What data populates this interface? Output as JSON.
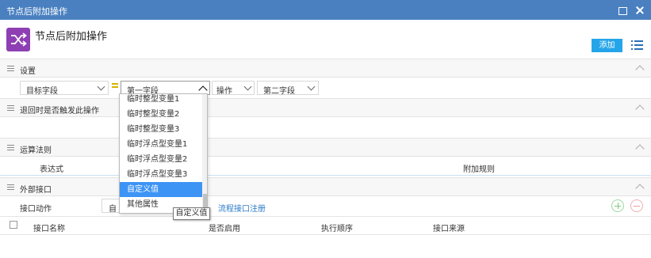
{
  "window": {
    "title": "节点后附加操作"
  },
  "header": {
    "title": "节点后附加操作",
    "add_label": "添加"
  },
  "sections": {
    "settings": "设置",
    "rollback": "退回时是否触发此操作",
    "rules": "运算法则",
    "external": "外部接口"
  },
  "settings_row": {
    "target_field": "目标字段",
    "first_field": "第一字段",
    "operation": "操作",
    "second_field": "第二字段"
  },
  "dropdown": {
    "items": [
      "临时整型变量1",
      "临时整型变量2",
      "临时整型变量3",
      "临时浮点型变量1",
      "临时浮点型变量2",
      "临时浮点型变量3",
      "自定义值",
      "其他属性"
    ],
    "selected": "自定义值"
  },
  "tooltip": "自定义值",
  "rules_table": {
    "columns": [
      "表达式",
      "附加规则"
    ]
  },
  "external": {
    "action_label": "接口动作",
    "action_value": "自",
    "register_link": "流程接口注册",
    "columns": [
      "接口名称",
      "是否启用",
      "执行顺序",
      "接口来源"
    ]
  },
  "colors": {
    "titlebar": "#4a80c0",
    "accent": "#25a5e9",
    "selected": "#3d94f5",
    "header_icon": "#8e3fb3"
  }
}
